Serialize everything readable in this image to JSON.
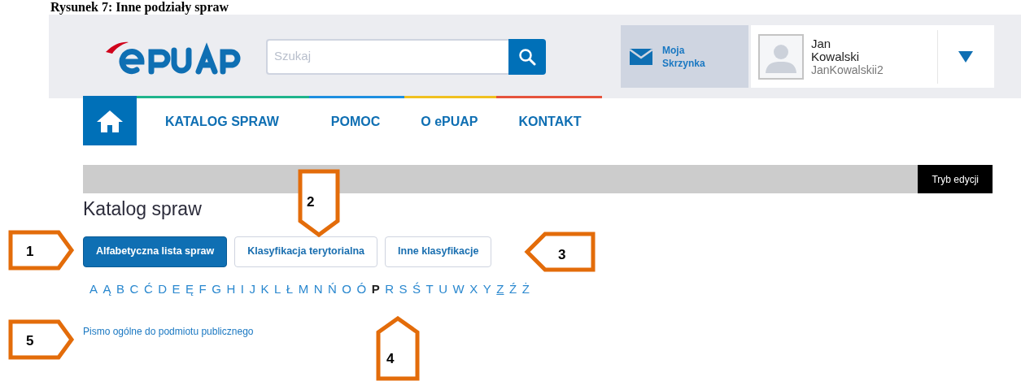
{
  "caption": "Rysunek 7: Inne podziały spraw",
  "header": {
    "search": {
      "placeholder": "Szukaj"
    },
    "mailbox": {
      "line1": "Moja",
      "line2": "Skrzynka"
    },
    "user": {
      "first_name": "Jan",
      "last_name": "Kowalski",
      "login": "JanKowalskii2"
    }
  },
  "nav": {
    "items": [
      "KATALOG SPRAW",
      "POMOC",
      "O ePUAP",
      "KONTAKT"
    ]
  },
  "toolbar": {
    "edit_button": "Tryb edycji"
  },
  "page_title": "Katalog spraw",
  "tabs": [
    {
      "label": "Alfabetyczna lista spraw",
      "selected": true
    },
    {
      "label": "Klasyfikacja terytorialna",
      "selected": false
    },
    {
      "label": "Inne klasyfikacje",
      "selected": false
    }
  ],
  "letters": [
    {
      "letter": "A",
      "selected": false,
      "underlined": false
    },
    {
      "letter": "Ą",
      "selected": false,
      "underlined": false
    },
    {
      "letter": "B",
      "selected": false,
      "underlined": false
    },
    {
      "letter": "C",
      "selected": false,
      "underlined": false
    },
    {
      "letter": "Ć",
      "selected": false,
      "underlined": false
    },
    {
      "letter": "D",
      "selected": false,
      "underlined": false
    },
    {
      "letter": "E",
      "selected": false,
      "underlined": false
    },
    {
      "letter": "Ę",
      "selected": false,
      "underlined": false
    },
    {
      "letter": "F",
      "selected": false,
      "underlined": false
    },
    {
      "letter": "G",
      "selected": false,
      "underlined": false
    },
    {
      "letter": "H",
      "selected": false,
      "underlined": false
    },
    {
      "letter": "I",
      "selected": false,
      "underlined": false
    },
    {
      "letter": "J",
      "selected": false,
      "underlined": false
    },
    {
      "letter": "K",
      "selected": false,
      "underlined": false
    },
    {
      "letter": "L",
      "selected": false,
      "underlined": false
    },
    {
      "letter": "Ł",
      "selected": false,
      "underlined": false
    },
    {
      "letter": "M",
      "selected": false,
      "underlined": false
    },
    {
      "letter": "N",
      "selected": false,
      "underlined": false
    },
    {
      "letter": "Ń",
      "selected": false,
      "underlined": false
    },
    {
      "letter": "O",
      "selected": false,
      "underlined": false
    },
    {
      "letter": "Ó",
      "selected": false,
      "underlined": false
    },
    {
      "letter": "P",
      "selected": true,
      "underlined": false
    },
    {
      "letter": "R",
      "selected": false,
      "underlined": false
    },
    {
      "letter": "S",
      "selected": false,
      "underlined": false
    },
    {
      "letter": "Ś",
      "selected": false,
      "underlined": false
    },
    {
      "letter": "T",
      "selected": false,
      "underlined": false
    },
    {
      "letter": "U",
      "selected": false,
      "underlined": false
    },
    {
      "letter": "W",
      "selected": false,
      "underlined": false
    },
    {
      "letter": "X",
      "selected": false,
      "underlined": false
    },
    {
      "letter": "Y",
      "selected": false,
      "underlined": false
    },
    {
      "letter": "Z",
      "selected": false,
      "underlined": true
    },
    {
      "letter": "Ź",
      "selected": false,
      "underlined": false
    },
    {
      "letter": "Ż",
      "selected": false,
      "underlined": false
    }
  ],
  "results": [
    "Pismo ogólne do podmiotu publicznego"
  ],
  "callouts": [
    {
      "label": "1",
      "kind": "rightward"
    },
    {
      "label": "2",
      "kind": "downward"
    },
    {
      "label": "3",
      "kind": "leftward"
    },
    {
      "label": "4",
      "kind": "upward"
    },
    {
      "label": "5",
      "kind": "rightward"
    }
  ]
}
